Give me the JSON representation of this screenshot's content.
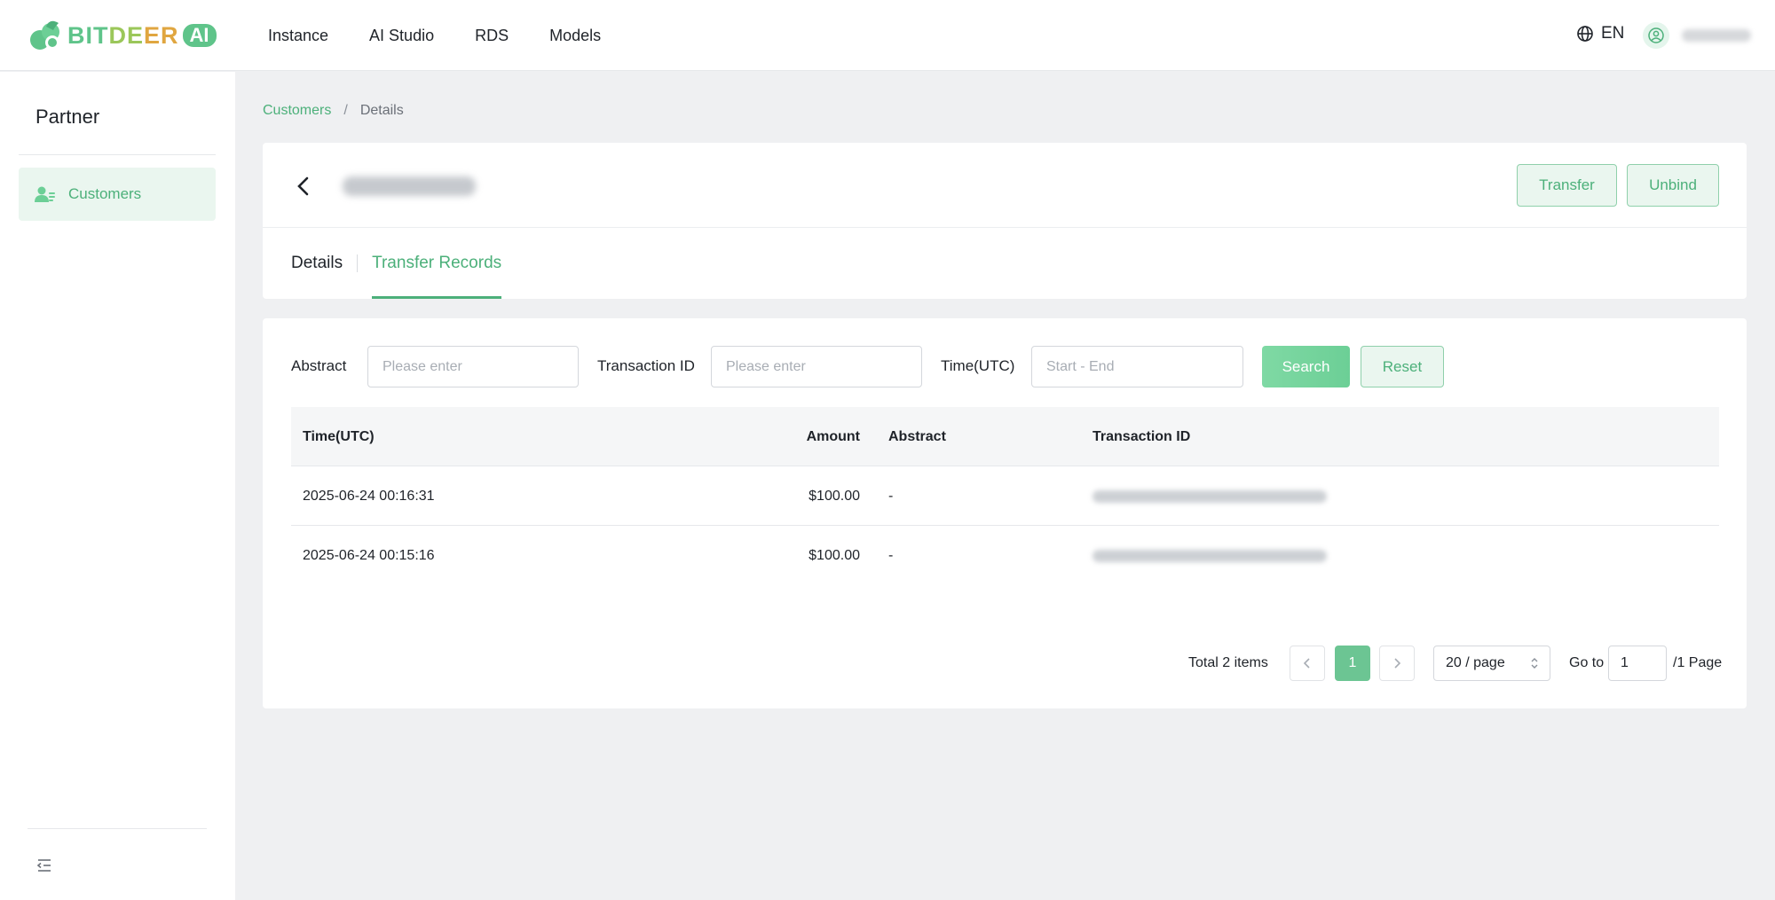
{
  "brand": {
    "name_part1": "BIT",
    "name_part2": "DE",
    "name_part3": "ER",
    "badge": "AI"
  },
  "nav": {
    "items": [
      "Instance",
      "AI Studio",
      "RDS",
      "Models"
    ]
  },
  "header": {
    "language": "EN"
  },
  "sidebar": {
    "title": "Partner",
    "items": [
      {
        "label": "Customers",
        "active": true
      }
    ]
  },
  "breadcrumb": {
    "root": "Customers",
    "separator": "/",
    "current": "Details"
  },
  "customer": {
    "buttons": {
      "transfer": "Transfer",
      "unbind": "Unbind"
    },
    "tabs": [
      {
        "label": "Details",
        "active": false
      },
      {
        "label": "Transfer Records",
        "active": true
      }
    ]
  },
  "filters": {
    "abstract_label": "Abstract",
    "abstract_placeholder": "Please enter",
    "txid_label": "Transaction ID",
    "txid_placeholder": "Please enter",
    "time_label": "Time(UTC)",
    "time_placeholder": "Start - End",
    "search": "Search",
    "reset": "Reset"
  },
  "table": {
    "columns": {
      "time": "Time(UTC)",
      "amount": "Amount",
      "abstract": "Abstract",
      "txid": "Transaction ID"
    },
    "rows": [
      {
        "time": "2025-06-24 00:16:31",
        "amount": "$100.00",
        "abstract": "-"
      },
      {
        "time": "2025-06-24 00:15:16",
        "amount": "$100.00",
        "abstract": "-"
      }
    ]
  },
  "pagination": {
    "total": "Total 2 items",
    "current": "1",
    "page_size": "20 / page",
    "goto_label": "Go to",
    "goto_value": "1",
    "goto_suffix": "/1 Page"
  },
  "colors": {
    "accent": "#4cb07a",
    "accent_light": "#eaf6ef",
    "background": "#eff0f2"
  }
}
